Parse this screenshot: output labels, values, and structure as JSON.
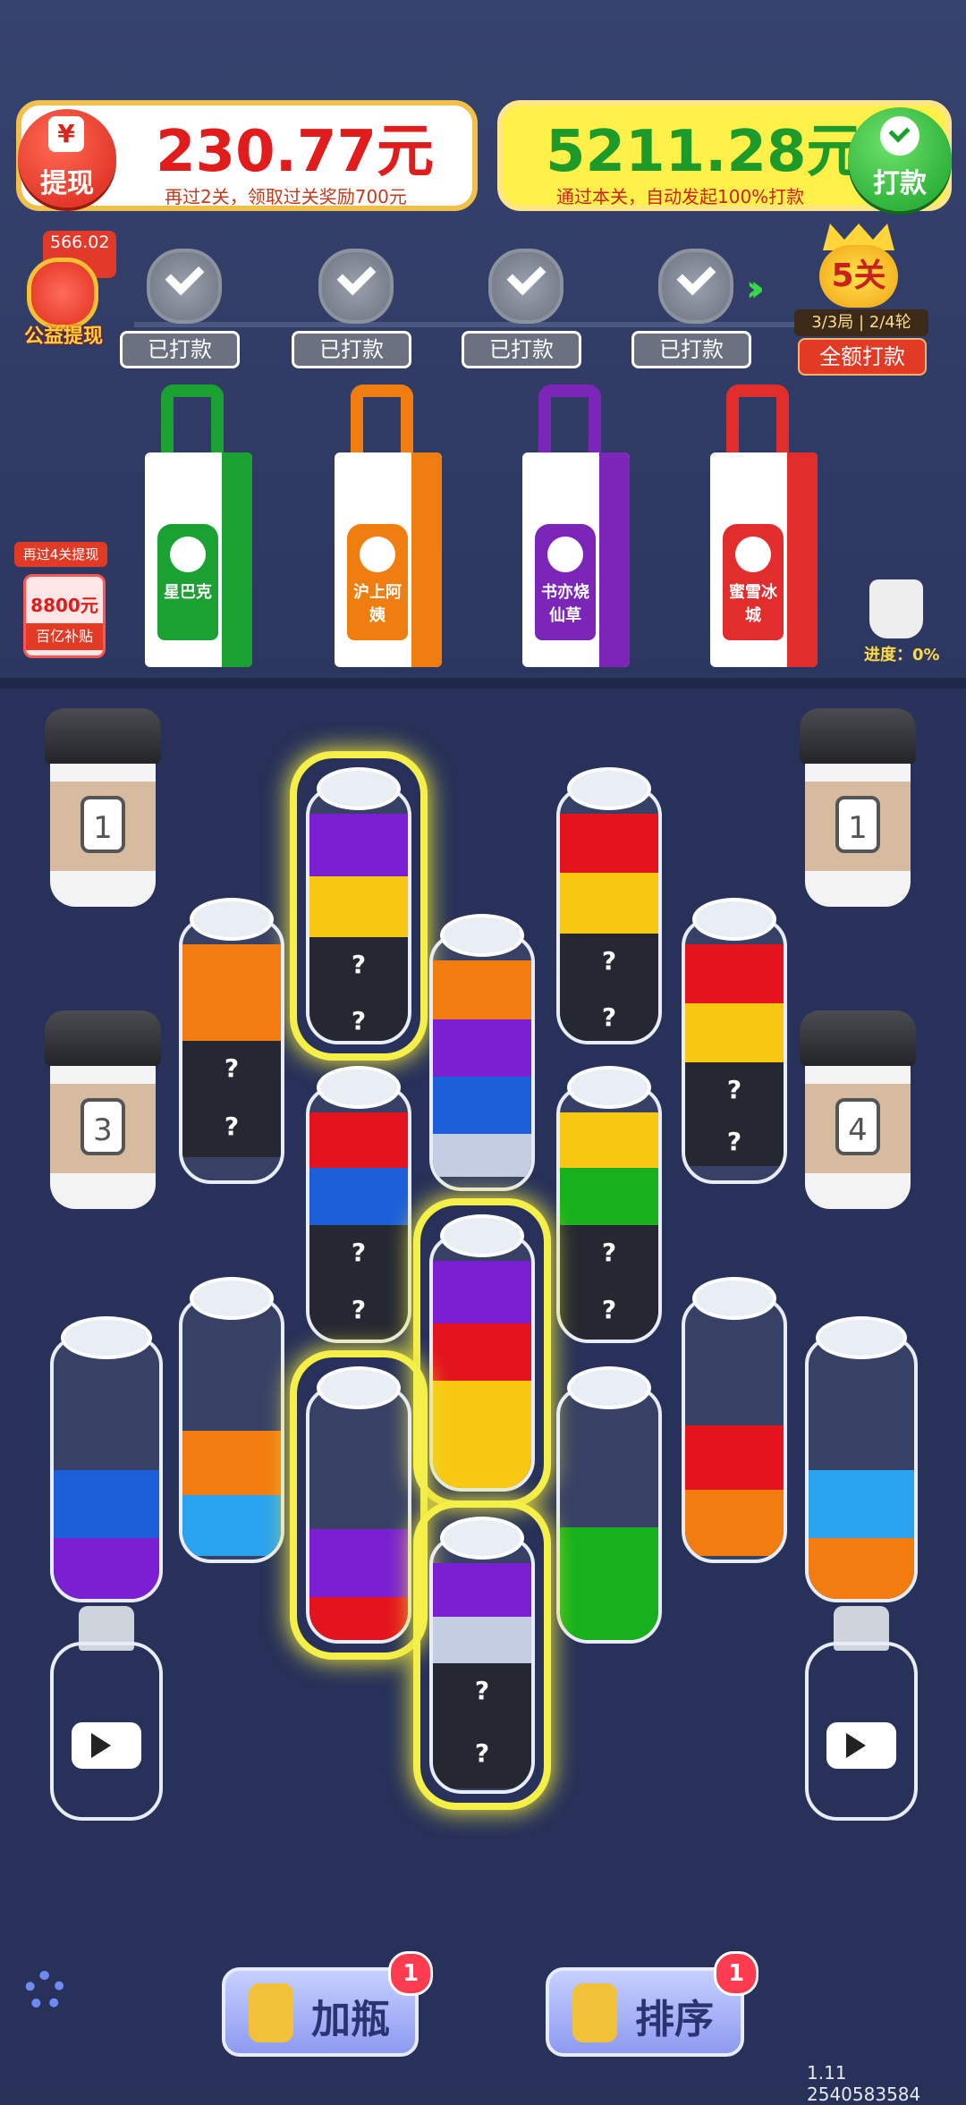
{
  "top_left": {
    "badge_label": "提现",
    "amount": "230.77元",
    "sub": "再过2关，领取过关奖励700元"
  },
  "top_right": {
    "amount": "5211.28元",
    "sub": "通过本关，自动发起100%打款",
    "badge_label": "打款"
  },
  "charity": {
    "value": "566.02元",
    "label": "公益提现"
  },
  "milestones": [
    {
      "label": "已打款"
    },
    {
      "label": "已打款"
    },
    {
      "label": "已打款"
    },
    {
      "label": "已打款"
    }
  ],
  "level": {
    "name": "5关",
    "rounds": "3/3局 | 2/4轮",
    "button": "全额打款"
  },
  "bags": [
    {
      "brand": "星巴克",
      "color": "#1aa131"
    },
    {
      "brand": "沪上阿姨",
      "color": "#f07d10"
    },
    {
      "brand": "书亦烧仙草",
      "color": "#7b26b8"
    },
    {
      "brand": "蜜雪冰城",
      "color": "#e22d2d"
    }
  ],
  "promo": {
    "tag": "再过4关提现",
    "amount": "8800元",
    "sub": "百亿补贴"
  },
  "progress": "进度：0%",
  "cups": [
    "1",
    "1",
    "3",
    "4"
  ],
  "colors": {
    "purple": "#7a1fd1",
    "yellow": "#f8c712",
    "red": "#e3141d",
    "orange": "#f27c10",
    "blue": "#1c5fd9",
    "lightblue": "#2aa3ef",
    "green": "#16b11c",
    "dark": "#252833",
    "pale": "#c5cde3"
  },
  "buttons": {
    "add_bottle": "加瓶",
    "add_bottle_count": "1",
    "sort": "排序",
    "sort_count": "1"
  },
  "version": "1.11 2540583584",
  "hidden_mark": "?"
}
